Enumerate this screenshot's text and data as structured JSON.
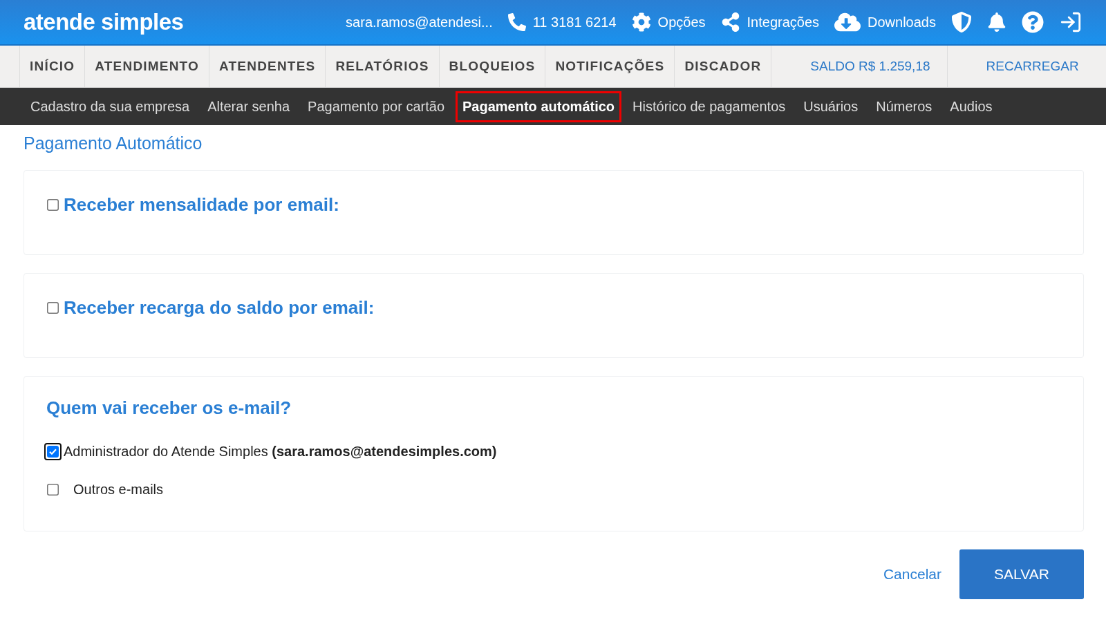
{
  "header": {
    "logo": "atende simples",
    "user_email": "sara.ramos@atendesi...",
    "phone": "11 3181 6214",
    "links": [
      {
        "kind": "options",
        "label": "Opções"
      },
      {
        "kind": "integrations",
        "label": "Integrações"
      },
      {
        "kind": "downloads",
        "label": "Downloads"
      }
    ]
  },
  "main_nav": {
    "items": [
      {
        "label": "INÍCIO",
        "selected": false
      },
      {
        "label": "ATENDIMENTO",
        "selected": false
      },
      {
        "label": "ATENDENTES",
        "selected": false
      },
      {
        "label": "RELATÓRIOS",
        "selected": false
      },
      {
        "label": "BLOQUEIOS",
        "selected": false
      },
      {
        "label": "NOTIFICAÇÕES",
        "selected": false
      },
      {
        "label": "DISCADOR",
        "selected": false
      }
    ],
    "balance": "SALDO R$ 1.259,18",
    "recharge": "RECARREGAR"
  },
  "sub_nav": {
    "items": [
      {
        "label": "Cadastro da sua empresa",
        "selected": false
      },
      {
        "label": "Alterar senha",
        "selected": false
      },
      {
        "label": "Pagamento por cartão",
        "selected": false
      },
      {
        "label": "Pagamento automático",
        "selected": true
      },
      {
        "label": "Histórico de pagamentos",
        "selected": false
      },
      {
        "label": "Usuários",
        "selected": false
      },
      {
        "label": "Números",
        "selected": false
      },
      {
        "label": "Audios",
        "selected": false
      }
    ]
  },
  "page_title": "Pagamento Automático",
  "sections": [
    {
      "label": "Receber mensalidade por email:",
      "checked": false
    },
    {
      "label": "Receber recarga do saldo por email:",
      "checked": false
    }
  ],
  "recipients": {
    "title": "Quem vai receber os e-mail?",
    "options": [
      {
        "label": "Administrador do Atende Simples **(sara.ramos@atendesimples.com)**",
        "checked": true,
        "focused": true
      },
      {
        "label": "Outros e-mails",
        "checked": false,
        "focused": false
      }
    ]
  },
  "actions": {
    "cancel": "Cancelar",
    "save": "SALVAR"
  }
}
